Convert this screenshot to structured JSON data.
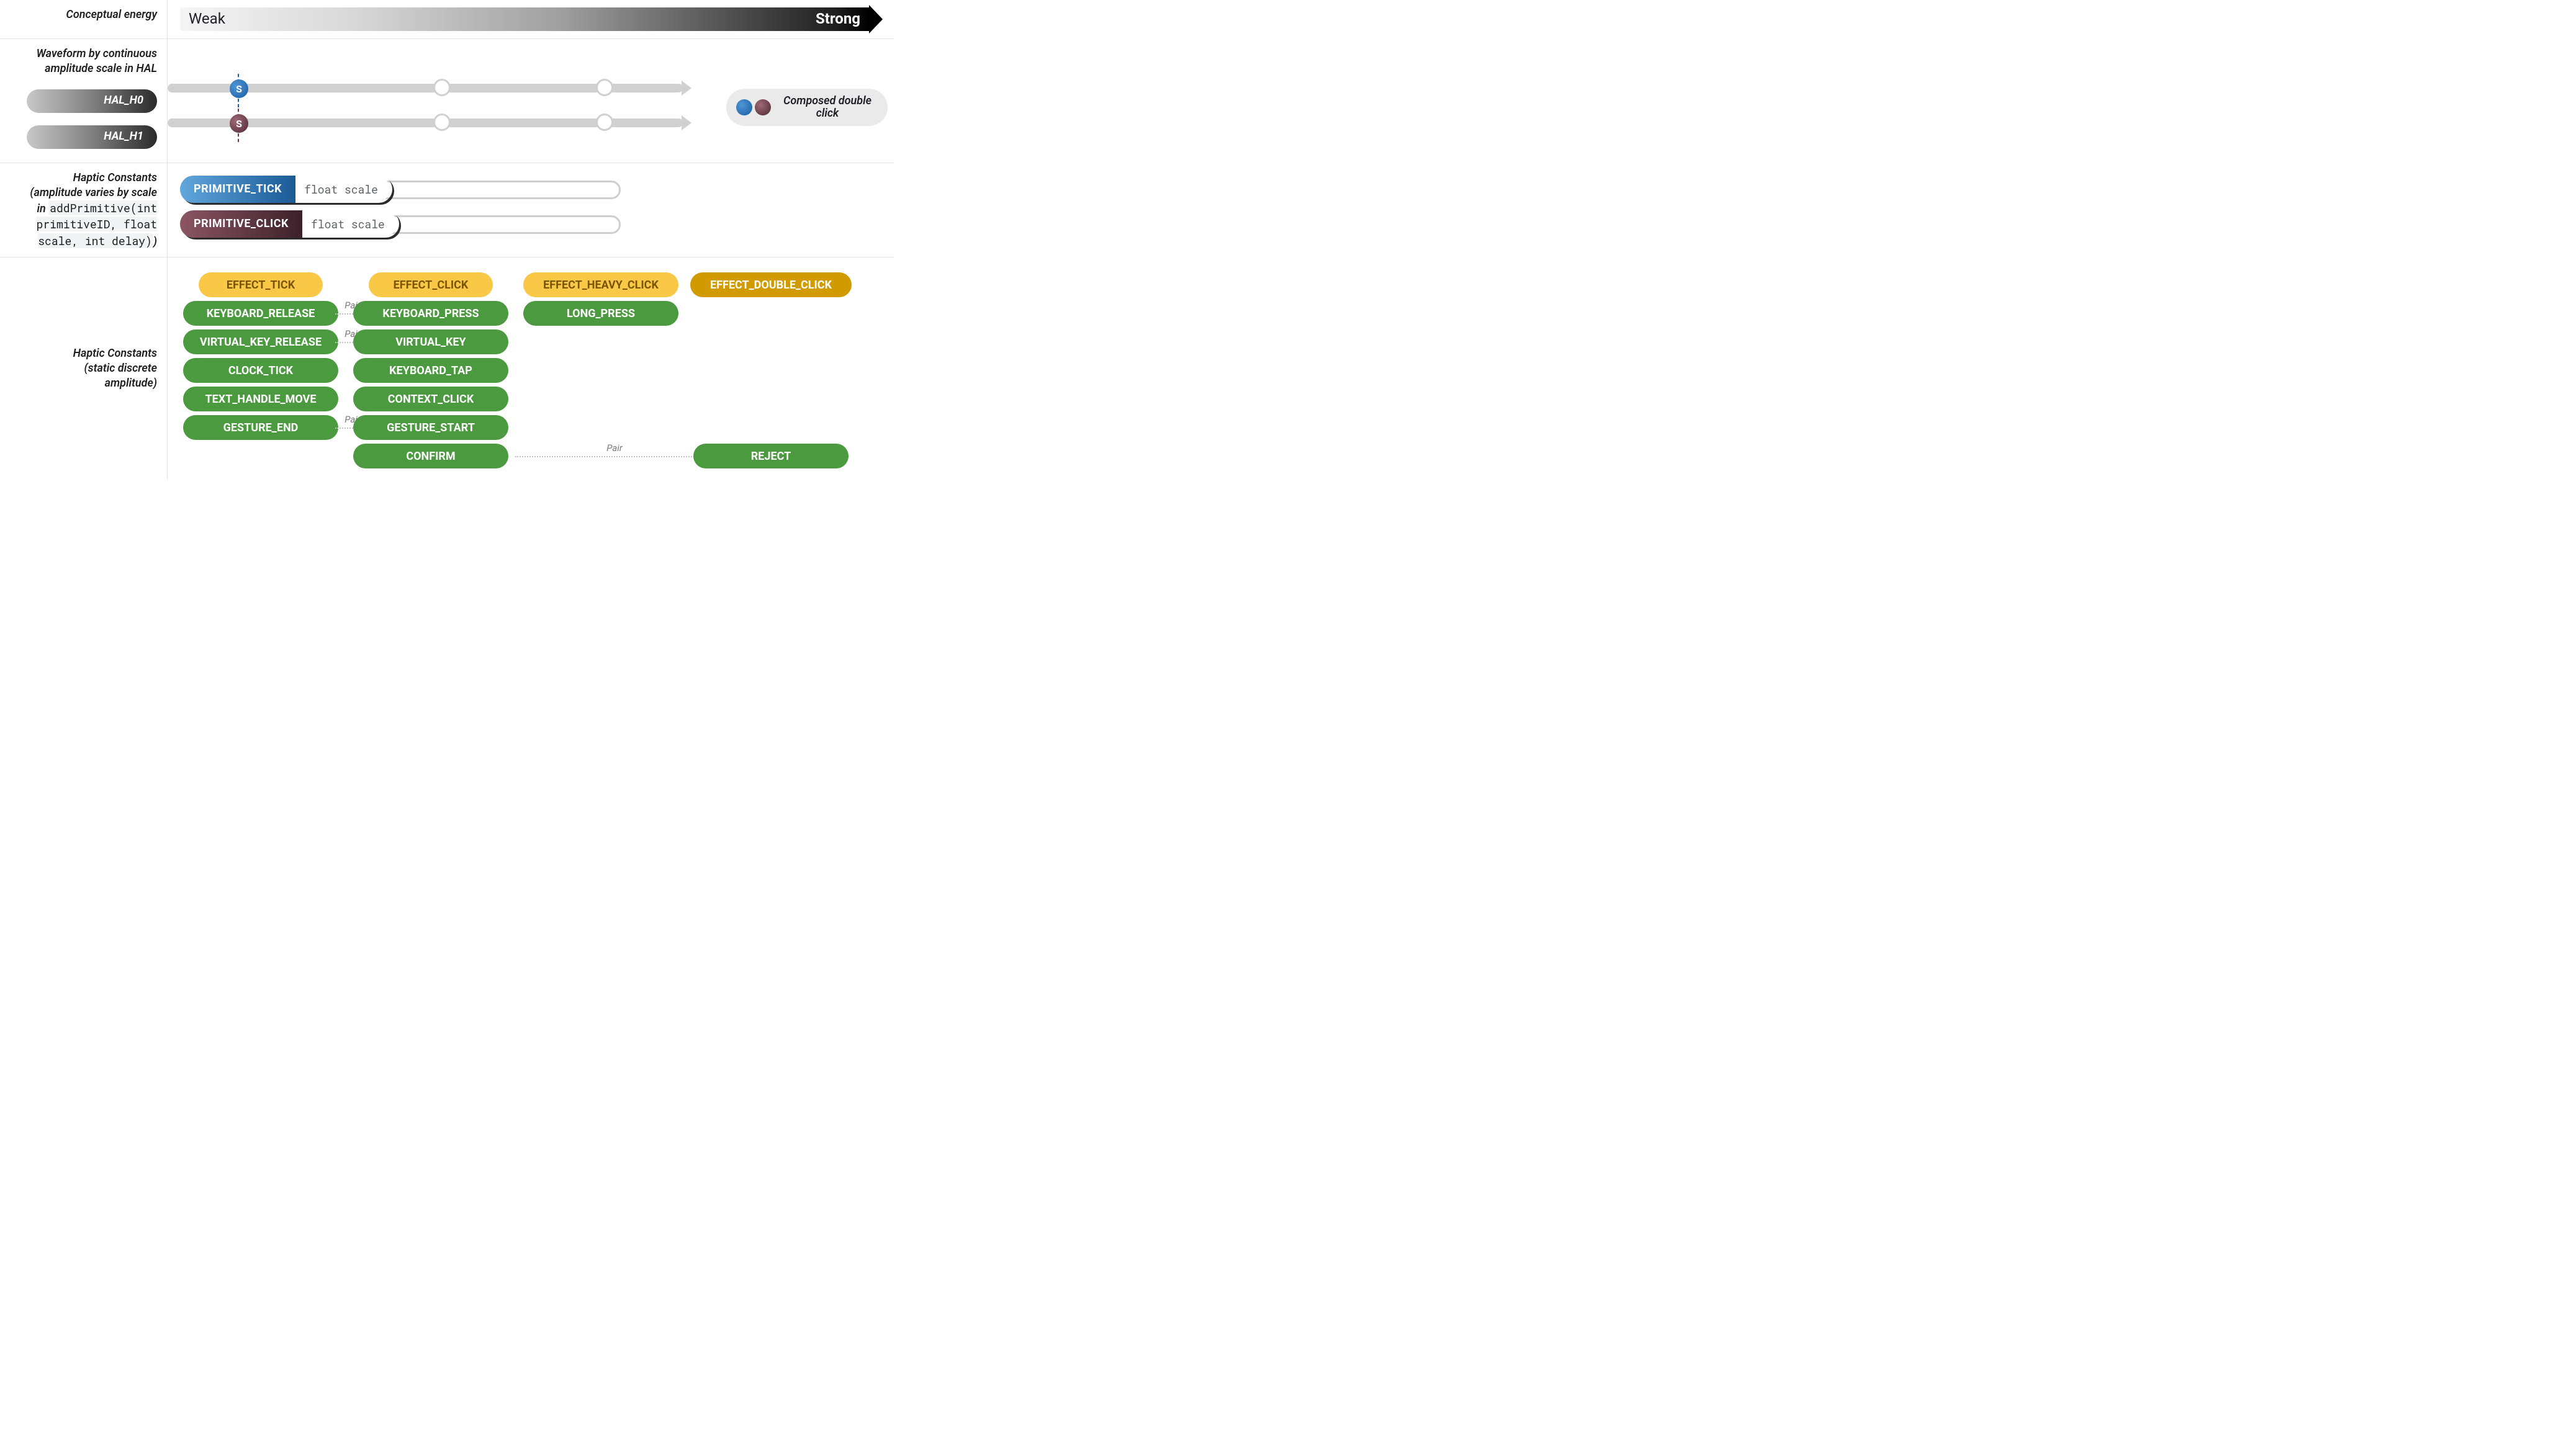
{
  "header": {
    "label": "Conceptual energy",
    "weak": "Weak",
    "strong": "Strong"
  },
  "waveform": {
    "label_line1": "Waveform by continuous",
    "label_line2": "amplitude scale in HAL",
    "hal0": "HAL_H0",
    "hal1": "HAL_H1",
    "s_marker": "S",
    "composed": "Composed double click"
  },
  "primitives": {
    "label_line1": "Haptic Constants",
    "label_line2": "(amplitude varies by scale",
    "label_in": "in ",
    "label_code": "addPrimitive(int primitiveID, float scale, int delay)",
    "label_close": ")",
    "tick": "PRIMITIVE_TICK",
    "click": "PRIMITIVE_CLICK",
    "float_scale": "float scale"
  },
  "static": {
    "label_line1": "Haptic Constants",
    "label_line2": "(static discrete",
    "label_line3": "amplitude)",
    "pair_label": "Pair",
    "effects": {
      "tick": "EFFECT_TICK",
      "click": "EFFECT_CLICK",
      "heavy": "EFFECT_HEAVY_CLICK",
      "double": "EFFECT_DOUBLE_CLICK"
    },
    "col1": [
      "KEYBOARD_RELEASE",
      "VIRTUAL_KEY_RELEASE",
      "CLOCK_TICK",
      "TEXT_HANDLE_MOVE",
      "GESTURE_END"
    ],
    "col2": [
      "KEYBOARD_PRESS",
      "VIRTUAL_KEY",
      "KEYBOARD_TAP",
      "CONTEXT_CLICK",
      "GESTURE_START",
      "CONFIRM"
    ],
    "col3": [
      "LONG_PRESS"
    ],
    "col4_last": "REJECT"
  }
}
